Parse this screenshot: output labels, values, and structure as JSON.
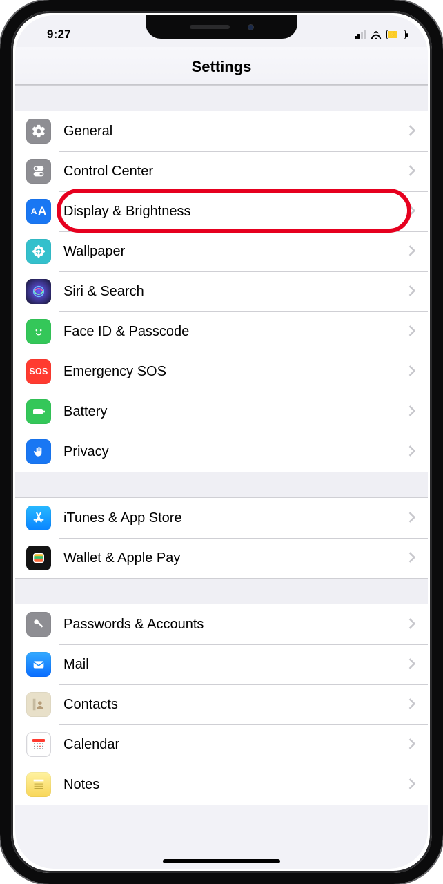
{
  "statusbar": {
    "time": "9:27"
  },
  "header": {
    "title": "Settings"
  },
  "groups": [
    {
      "items": [
        {
          "id": "general",
          "label": "General",
          "icon": "gear",
          "color": "#8e8e93"
        },
        {
          "id": "control-center",
          "label": "Control Center",
          "icon": "switches",
          "color": "#8e8e93"
        },
        {
          "id": "display-brightness",
          "label": "Display & Brightness",
          "icon": "textsize",
          "color": "#1977f3",
          "highlighted": true
        },
        {
          "id": "wallpaper",
          "label": "Wallpaper",
          "icon": "flower",
          "color": "#34c0cc"
        },
        {
          "id": "siri-search",
          "label": "Siri & Search",
          "icon": "siri",
          "color": "#1b1b2f"
        },
        {
          "id": "faceid-passcode",
          "label": "Face ID & Passcode",
          "icon": "face",
          "color": "#34c759"
        },
        {
          "id": "emergency-sos",
          "label": "Emergency SOS",
          "icon": "sos",
          "color": "#ff3b30"
        },
        {
          "id": "battery",
          "label": "Battery",
          "icon": "battery",
          "color": "#34c759"
        },
        {
          "id": "privacy",
          "label": "Privacy",
          "icon": "hand",
          "color": "#1977f3"
        }
      ]
    },
    {
      "items": [
        {
          "id": "itunes-appstore",
          "label": "iTunes & App Store",
          "icon": "appstore",
          "color": "#1aa0ff"
        },
        {
          "id": "wallet-applepay",
          "label": "Wallet & Apple Pay",
          "icon": "wallet",
          "color": "#141414"
        }
      ]
    },
    {
      "items": [
        {
          "id": "passwords-accounts",
          "label": "Passwords & Accounts",
          "icon": "key",
          "color": "#8e8e93"
        },
        {
          "id": "mail",
          "label": "Mail",
          "icon": "mail",
          "color": "#1a8cff"
        },
        {
          "id": "contacts",
          "label": "Contacts",
          "icon": "contacts",
          "color": "#d1c5a6"
        },
        {
          "id": "calendar",
          "label": "Calendar",
          "icon": "calendar",
          "color": "#ffffff"
        },
        {
          "id": "notes",
          "label": "Notes",
          "icon": "notes",
          "color": "#f7e27a"
        }
      ]
    }
  ]
}
